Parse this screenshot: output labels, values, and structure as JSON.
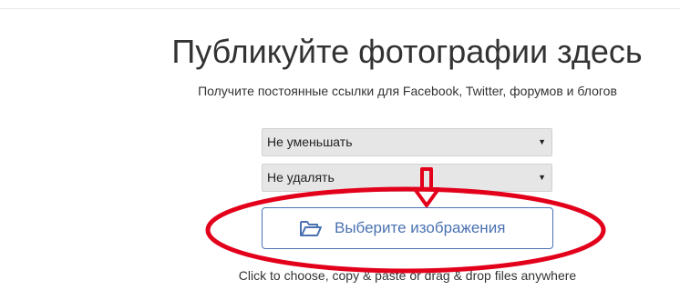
{
  "header": {
    "title": "Публикуйте фотографии здесь",
    "subtitle": "Получите постоянные ссылки для Facebook, Twitter, форумов и блогов"
  },
  "upload": {
    "resize_select": {
      "value": "Не уменьшать"
    },
    "expire_select": {
      "value": "Не удалять"
    },
    "choose_button_label": "Выберите изображения",
    "hint": "Click to choose, copy & paste or drag & drop files anywhere"
  },
  "colors": {
    "accent": "#4a72b2",
    "annotation": "#e3001b"
  },
  "icons": {
    "choose_button": "folder-open-icon",
    "select_caret": "triangle-down-icon"
  }
}
